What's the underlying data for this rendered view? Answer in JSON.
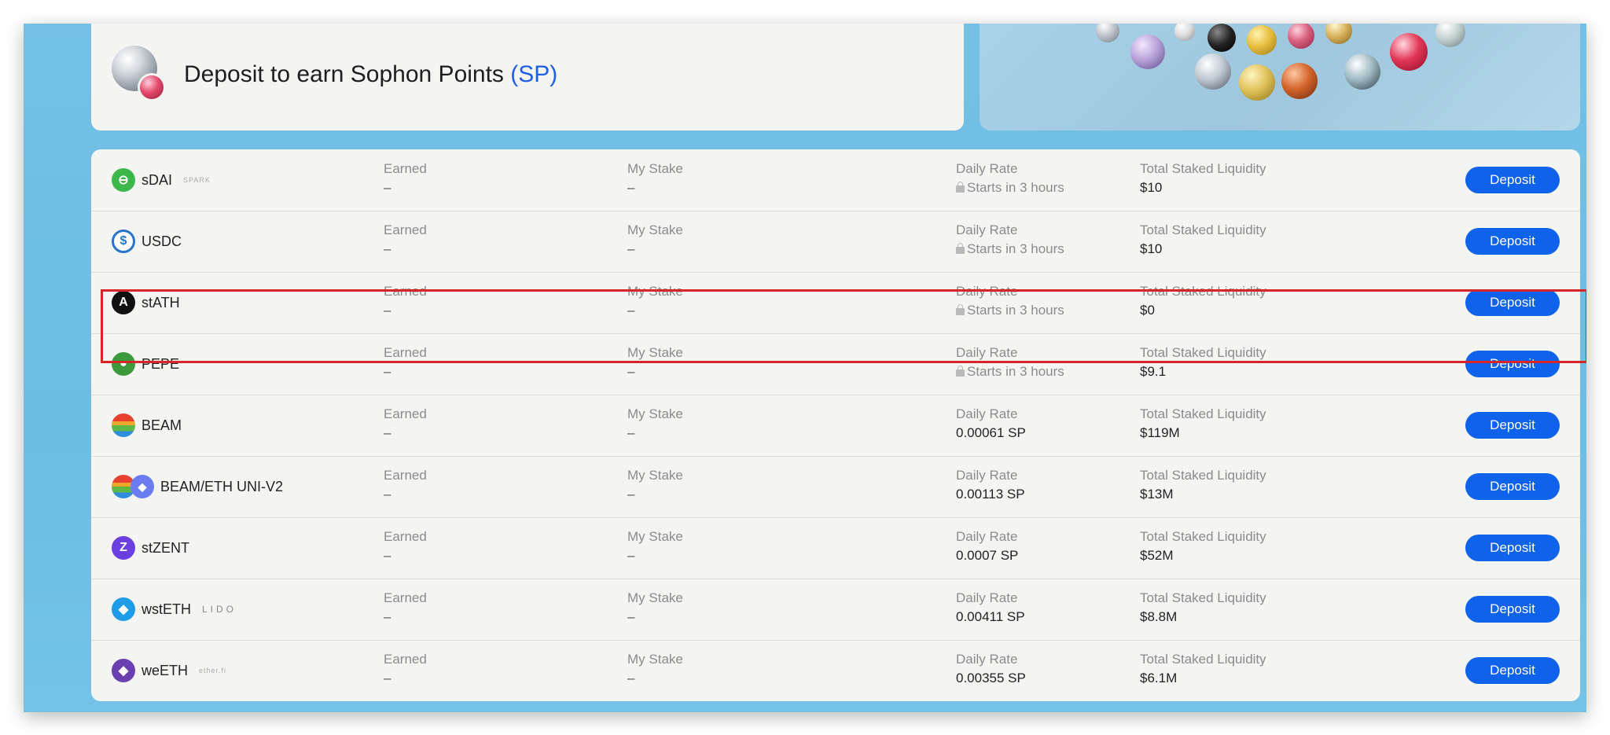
{
  "header": {
    "title": "Deposit to earn Sophon Points",
    "title_accent": "(SP)"
  },
  "columns": {
    "earned": "Earned",
    "my_stake": "My Stake",
    "daily_rate": "Daily Rate",
    "total_staked": "Total Staked Liquidity"
  },
  "colors": {
    "accent": "#0e62ec",
    "highlight": "#d6262a"
  },
  "rows": [
    {
      "name": "sDAI",
      "tag": "SPARK",
      "icon": "sdai-icon",
      "icon_color": "#3cb84a",
      "earned": "–",
      "my_stake": "–",
      "daily_rate": "Starts in 3 hours",
      "rate_locked": true,
      "total": "$10",
      "button": "Deposit"
    },
    {
      "name": "USDC",
      "tag": "",
      "icon": "usdc-icon",
      "icon_color": "#2775ca",
      "earned": "–",
      "my_stake": "–",
      "daily_rate": "Starts in 3 hours",
      "rate_locked": true,
      "total": "$10",
      "button": "Deposit"
    },
    {
      "name": "stATH",
      "tag": "",
      "icon": "stath-icon",
      "icon_color": "#111111",
      "earned": "–",
      "my_stake": "–",
      "daily_rate": "Starts in 3 hours",
      "rate_locked": true,
      "total": "$0",
      "button": "Deposit"
    },
    {
      "name": "PEPE",
      "tag": "",
      "icon": "pepe-icon",
      "icon_color": "#3d9a3c",
      "earned": "–",
      "my_stake": "–",
      "daily_rate": "Starts in 3 hours",
      "rate_locked": true,
      "total": "$9.1",
      "button": "Deposit"
    },
    {
      "name": "BEAM",
      "tag": "",
      "icon": "beam-icon",
      "icon_color": "#e8412f",
      "earned": "–",
      "my_stake": "–",
      "daily_rate": "0.00061 SP",
      "rate_locked": false,
      "total": "$119M",
      "button": "Deposit"
    },
    {
      "name": "BEAM/ETH UNI-V2",
      "tag": "",
      "icon": "beam-eth-icon",
      "icon_color": "#e8412f",
      "earned": "–",
      "my_stake": "–",
      "daily_rate": "0.00113 SP",
      "rate_locked": false,
      "total": "$13M",
      "button": "Deposit"
    },
    {
      "name": "stZENT",
      "tag": "",
      "icon": "stzent-icon",
      "icon_color": "#6b3fe0",
      "earned": "–",
      "my_stake": "–",
      "daily_rate": "0.0007 SP",
      "rate_locked": false,
      "total": "$52M",
      "button": "Deposit"
    },
    {
      "name": "wstETH",
      "tag": "LIDO",
      "icon": "wsteth-icon",
      "icon_color": "#1f9ce8",
      "earned": "–",
      "my_stake": "–",
      "daily_rate": "0.00411 SP",
      "rate_locked": false,
      "total": "$8.8M",
      "button": "Deposit"
    },
    {
      "name": "weETH",
      "tag": "ether.fi",
      "icon": "weeth-icon",
      "icon_color": "#6a3fb0",
      "earned": "–",
      "my_stake": "–",
      "daily_rate": "0.00355 SP",
      "rate_locked": false,
      "total": "$6.1M",
      "button": "Deposit"
    }
  ]
}
